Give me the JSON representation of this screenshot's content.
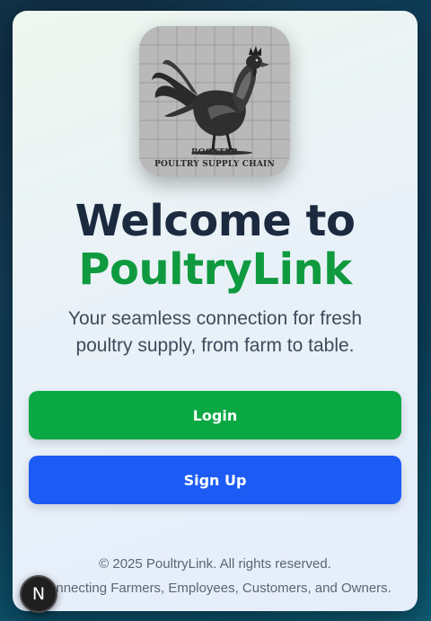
{
  "logo": {
    "caption_line1": "ROOSTER",
    "caption_line2": "POULTRY SUPPLY CHAIN"
  },
  "hero": {
    "title_line1": "Welcome to",
    "title_line2": "PoultryLink",
    "subtitle": "Your seamless connection for fresh poultry supply, from farm to table."
  },
  "actions": {
    "login_label": "Login",
    "signup_label": "Sign Up"
  },
  "footer": {
    "copyright": "© 2025 PoultryLink. All rights reserved.",
    "tagline": "Connecting Farmers, Employees, Customers, and Owners."
  },
  "dev_badge": {
    "letter": "N"
  },
  "colors": {
    "brand_green": "#0f9a3f",
    "login_button": "#0aa843",
    "signup_button": "#1c5cf5",
    "title_dark": "#1b2a3f"
  }
}
